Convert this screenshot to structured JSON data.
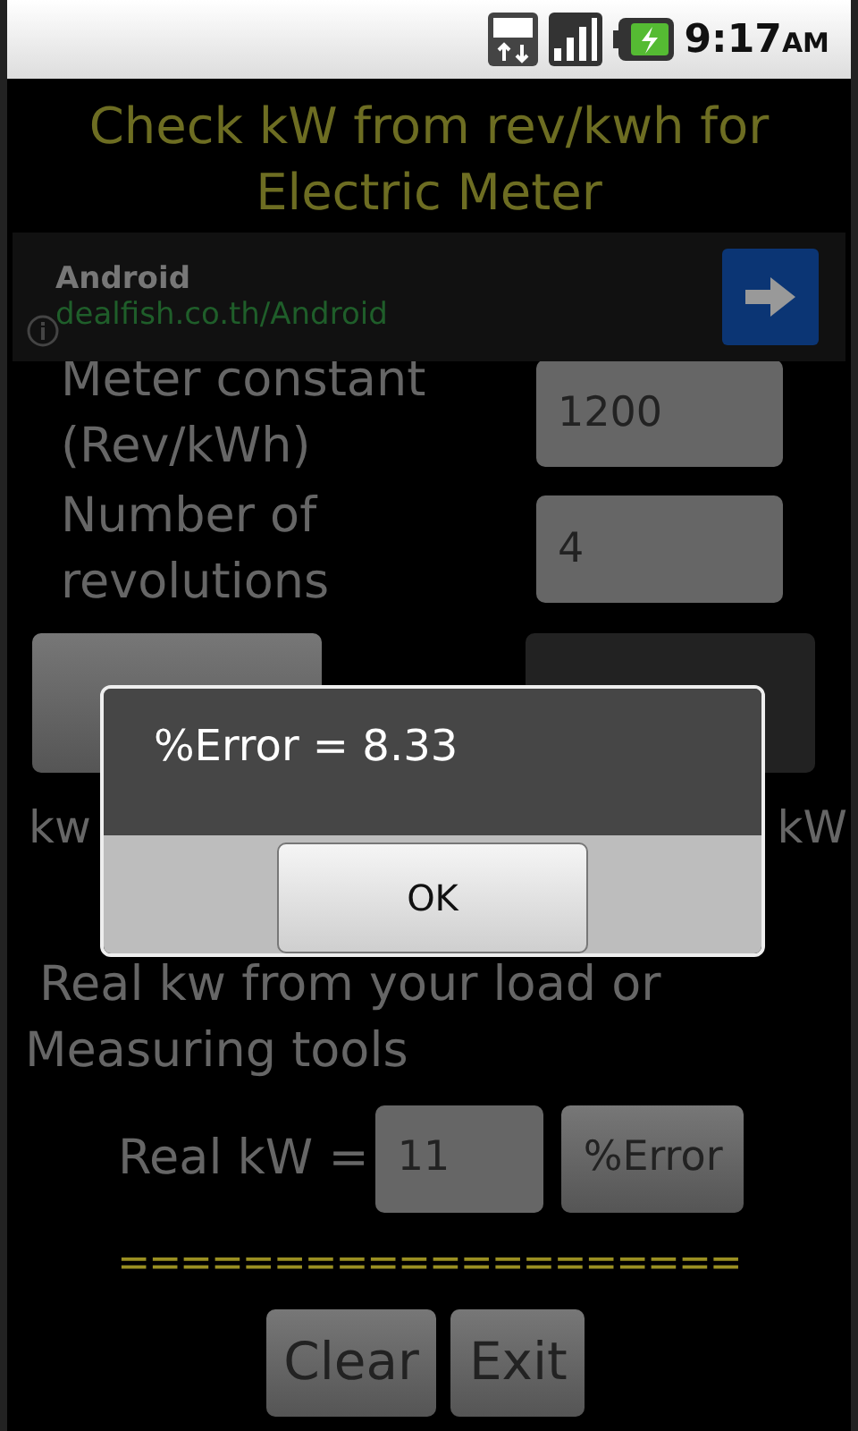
{
  "status_bar": {
    "time": "9:17",
    "ampm": "AM"
  },
  "title": "Check kW from rev/kwh for Electric Meter",
  "ad": {
    "title": "Android",
    "url": "dealfish.co.th/Android"
  },
  "inputs": [
    {
      "label": "Meter constant (Rev/kWh)",
      "value": "1200"
    },
    {
      "label": "Number of revolutions",
      "value": "4"
    }
  ],
  "meter_result": {
    "label": "kw",
    "unit": "kW"
  },
  "real_section": {
    "heading": "Real kw from your load or Measuring tools",
    "label": "Real kW =",
    "value": "11",
    "button": "%Error"
  },
  "divider_2": "====================",
  "buttons": [
    "Clear",
    "Exit"
  ],
  "dialog": {
    "message": "%Error = 8.33",
    "button": "OK"
  }
}
